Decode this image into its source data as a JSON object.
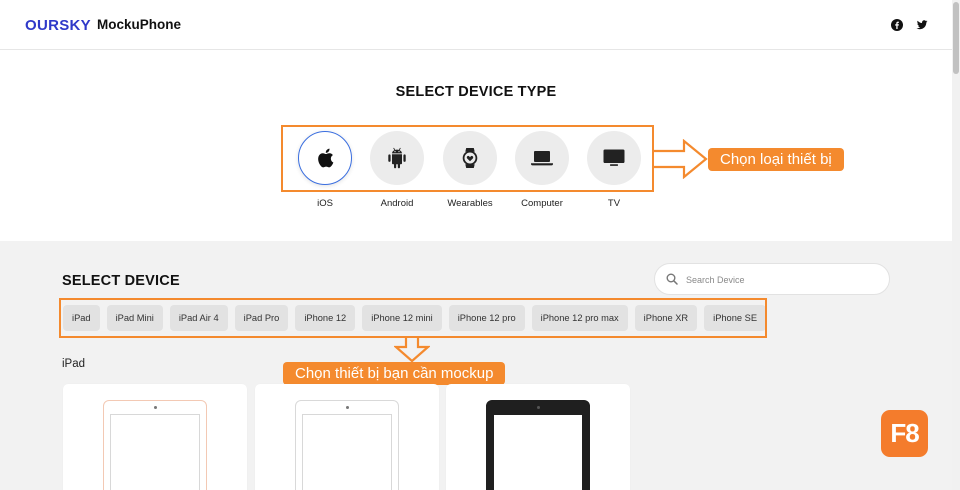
{
  "header": {
    "logo": "OURSKY",
    "app_title": "MockuPhone",
    "social": [
      {
        "icon": "facebook-icon"
      },
      {
        "icon": "twitter-icon"
      }
    ]
  },
  "device_types": {
    "heading": "SELECT DEVICE TYPE",
    "items": [
      {
        "label": "iOS",
        "icon": "apple-icon",
        "active": true
      },
      {
        "label": "Android",
        "icon": "android-icon",
        "active": false
      },
      {
        "label": "Wearables",
        "icon": "watch-icon",
        "active": false
      },
      {
        "label": "Computer",
        "icon": "laptop-icon",
        "active": false
      },
      {
        "label": "TV",
        "icon": "tv-icon",
        "active": false
      }
    ],
    "callout": "Chọn loại thiết bị"
  },
  "devices": {
    "heading": "SELECT DEVICE",
    "search": {
      "placeholder": "Search Device",
      "value": ""
    },
    "chips": [
      "iPad",
      "iPad Mini",
      "iPad Air 4",
      "iPad Pro",
      "iPhone 12",
      "iPhone 12 mini",
      "iPhone 12 pro",
      "iPhone 12 pro max",
      "iPhone XR",
      "iPhone SE"
    ],
    "callout": "Chọn thiết bị bạn cần mockup",
    "group_label": "iPad",
    "cards": [
      {
        "frame_color": "#f3c9b4"
      },
      {
        "frame_color": "#d9d9d9"
      },
      {
        "frame_color": "#1f1f1f"
      }
    ]
  },
  "badge": {
    "label": "F8"
  },
  "colors": {
    "accent": "#f48a2e",
    "brand": "#2f39c9",
    "active_ring": "#3b6fe0"
  }
}
